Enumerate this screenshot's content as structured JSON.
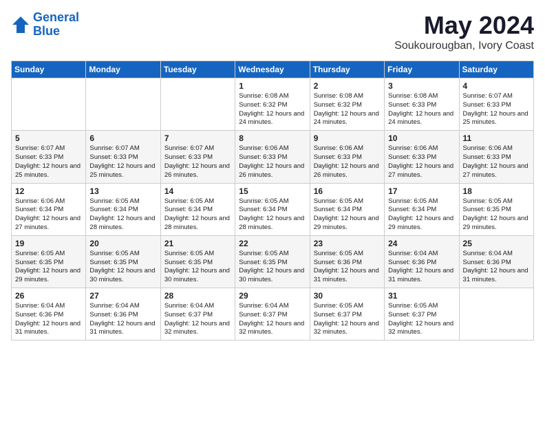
{
  "header": {
    "logo_line1": "General",
    "logo_line2": "Blue",
    "month": "May 2024",
    "location": "Soukourougban, Ivory Coast"
  },
  "days_of_week": [
    "Sunday",
    "Monday",
    "Tuesday",
    "Wednesday",
    "Thursday",
    "Friday",
    "Saturday"
  ],
  "weeks": [
    [
      {
        "day": "",
        "text": ""
      },
      {
        "day": "",
        "text": ""
      },
      {
        "day": "",
        "text": ""
      },
      {
        "day": "1",
        "text": "Sunrise: 6:08 AM\nSunset: 6:32 PM\nDaylight: 12 hours and 24 minutes."
      },
      {
        "day": "2",
        "text": "Sunrise: 6:08 AM\nSunset: 6:32 PM\nDaylight: 12 hours and 24 minutes."
      },
      {
        "day": "3",
        "text": "Sunrise: 6:08 AM\nSunset: 6:33 PM\nDaylight: 12 hours and 24 minutes."
      },
      {
        "day": "4",
        "text": "Sunrise: 6:07 AM\nSunset: 6:33 PM\nDaylight: 12 hours and 25 minutes."
      }
    ],
    [
      {
        "day": "5",
        "text": "Sunrise: 6:07 AM\nSunset: 6:33 PM\nDaylight: 12 hours and 25 minutes."
      },
      {
        "day": "6",
        "text": "Sunrise: 6:07 AM\nSunset: 6:33 PM\nDaylight: 12 hours and 25 minutes."
      },
      {
        "day": "7",
        "text": "Sunrise: 6:07 AM\nSunset: 6:33 PM\nDaylight: 12 hours and 26 minutes."
      },
      {
        "day": "8",
        "text": "Sunrise: 6:06 AM\nSunset: 6:33 PM\nDaylight: 12 hours and 26 minutes."
      },
      {
        "day": "9",
        "text": "Sunrise: 6:06 AM\nSunset: 6:33 PM\nDaylight: 12 hours and 26 minutes."
      },
      {
        "day": "10",
        "text": "Sunrise: 6:06 AM\nSunset: 6:33 PM\nDaylight: 12 hours and 27 minutes."
      },
      {
        "day": "11",
        "text": "Sunrise: 6:06 AM\nSunset: 6:33 PM\nDaylight: 12 hours and 27 minutes."
      }
    ],
    [
      {
        "day": "12",
        "text": "Sunrise: 6:06 AM\nSunset: 6:34 PM\nDaylight: 12 hours and 27 minutes."
      },
      {
        "day": "13",
        "text": "Sunrise: 6:05 AM\nSunset: 6:34 PM\nDaylight: 12 hours and 28 minutes."
      },
      {
        "day": "14",
        "text": "Sunrise: 6:05 AM\nSunset: 6:34 PM\nDaylight: 12 hours and 28 minutes."
      },
      {
        "day": "15",
        "text": "Sunrise: 6:05 AM\nSunset: 6:34 PM\nDaylight: 12 hours and 28 minutes."
      },
      {
        "day": "16",
        "text": "Sunrise: 6:05 AM\nSunset: 6:34 PM\nDaylight: 12 hours and 29 minutes."
      },
      {
        "day": "17",
        "text": "Sunrise: 6:05 AM\nSunset: 6:34 PM\nDaylight: 12 hours and 29 minutes."
      },
      {
        "day": "18",
        "text": "Sunrise: 6:05 AM\nSunset: 6:35 PM\nDaylight: 12 hours and 29 minutes."
      }
    ],
    [
      {
        "day": "19",
        "text": "Sunrise: 6:05 AM\nSunset: 6:35 PM\nDaylight: 12 hours and 29 minutes."
      },
      {
        "day": "20",
        "text": "Sunrise: 6:05 AM\nSunset: 6:35 PM\nDaylight: 12 hours and 30 minutes."
      },
      {
        "day": "21",
        "text": "Sunrise: 6:05 AM\nSunset: 6:35 PM\nDaylight: 12 hours and 30 minutes."
      },
      {
        "day": "22",
        "text": "Sunrise: 6:05 AM\nSunset: 6:35 PM\nDaylight: 12 hours and 30 minutes."
      },
      {
        "day": "23",
        "text": "Sunrise: 6:05 AM\nSunset: 6:36 PM\nDaylight: 12 hours and 31 minutes."
      },
      {
        "day": "24",
        "text": "Sunrise: 6:04 AM\nSunset: 6:36 PM\nDaylight: 12 hours and 31 minutes."
      },
      {
        "day": "25",
        "text": "Sunrise: 6:04 AM\nSunset: 6:36 PM\nDaylight: 12 hours and 31 minutes."
      }
    ],
    [
      {
        "day": "26",
        "text": "Sunrise: 6:04 AM\nSunset: 6:36 PM\nDaylight: 12 hours and 31 minutes."
      },
      {
        "day": "27",
        "text": "Sunrise: 6:04 AM\nSunset: 6:36 PM\nDaylight: 12 hours and 31 minutes."
      },
      {
        "day": "28",
        "text": "Sunrise: 6:04 AM\nSunset: 6:37 PM\nDaylight: 12 hours and 32 minutes."
      },
      {
        "day": "29",
        "text": "Sunrise: 6:04 AM\nSunset: 6:37 PM\nDaylight: 12 hours and 32 minutes."
      },
      {
        "day": "30",
        "text": "Sunrise: 6:05 AM\nSunset: 6:37 PM\nDaylight: 12 hours and 32 minutes."
      },
      {
        "day": "31",
        "text": "Sunrise: 6:05 AM\nSunset: 6:37 PM\nDaylight: 12 hours and 32 minutes."
      },
      {
        "day": "",
        "text": ""
      }
    ]
  ]
}
